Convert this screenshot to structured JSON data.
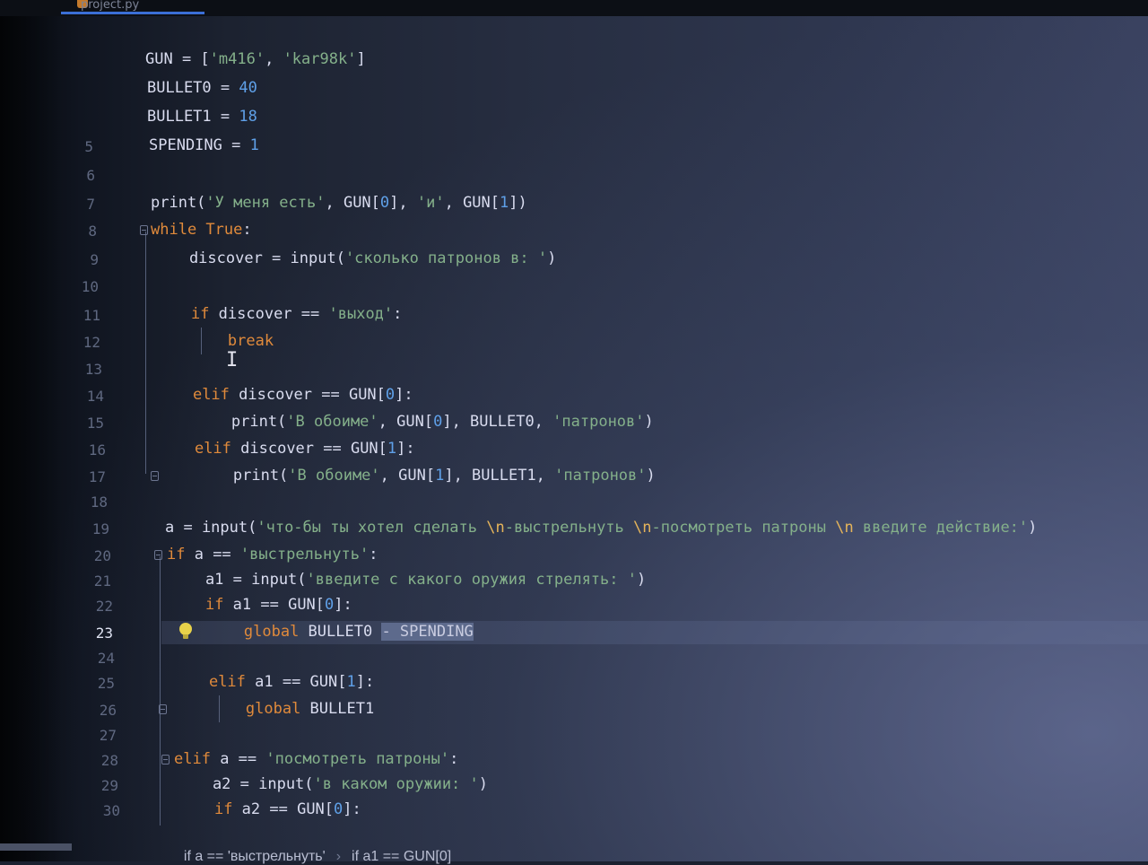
{
  "tab": {
    "label": "project.py"
  },
  "editor": {
    "lines": [
      {
        "n": "",
        "segs": [
          [
            "GUN = [",
            "d"
          ],
          [
            "'m416'",
            "s"
          ],
          [
            ", ",
            "d"
          ],
          [
            "'kar98k'",
            "s"
          ],
          [
            "]",
            "d"
          ]
        ]
      },
      {
        "n": "",
        "segs": [
          [
            "BULLET0 = ",
            "d"
          ],
          [
            "40",
            "n"
          ]
        ]
      },
      {
        "n": "",
        "segs": [
          [
            "BULLET1 = ",
            "d"
          ],
          [
            "18",
            "n"
          ]
        ]
      },
      {
        "n": "5",
        "segs": [
          [
            "SPENDING = ",
            "d"
          ],
          [
            "1",
            "n"
          ]
        ]
      },
      {
        "n": "6",
        "segs": []
      },
      {
        "n": "7",
        "segs": [
          [
            "print(",
            "d"
          ],
          [
            "'У меня есть'",
            "s"
          ],
          [
            ", GUN[",
            "d"
          ],
          [
            "0",
            "n"
          ],
          [
            "], ",
            "d"
          ],
          [
            "'и'",
            "s"
          ],
          [
            ", GUN[",
            "d"
          ],
          [
            "1",
            "n"
          ],
          [
            "])",
            "d"
          ]
        ]
      },
      {
        "n": "8",
        "segs": [
          [
            "while True",
            "k"
          ],
          [
            ":",
            "d"
          ]
        ]
      },
      {
        "n": "9",
        "segs": [
          [
            "    discover = input(",
            "d"
          ],
          [
            "'сколько патронов в: '",
            "s"
          ],
          [
            ")",
            "d"
          ]
        ]
      },
      {
        "n": "10",
        "segs": []
      },
      {
        "n": "11",
        "segs": [
          [
            "    ",
            "d"
          ],
          [
            "if",
            "k"
          ],
          [
            " discover == ",
            "d"
          ],
          [
            "'выход'",
            "s"
          ],
          [
            ":",
            "d"
          ]
        ]
      },
      {
        "n": "12",
        "segs": [
          [
            "        ",
            "d"
          ],
          [
            "break",
            "k"
          ]
        ]
      },
      {
        "n": "13",
        "segs": []
      },
      {
        "n": "14",
        "segs": [
          [
            "    ",
            "d"
          ],
          [
            "elif",
            "k"
          ],
          [
            " discover == GUN[",
            "d"
          ],
          [
            "0",
            "n"
          ],
          [
            "]:",
            "d"
          ]
        ]
      },
      {
        "n": "15",
        "segs": [
          [
            "        print(",
            "d"
          ],
          [
            "'В обоиме'",
            "s"
          ],
          [
            ", GUN[",
            "d"
          ],
          [
            "0",
            "n"
          ],
          [
            "], BULLET0, ",
            "d"
          ],
          [
            "'патронов'",
            "s"
          ],
          [
            ")",
            "d"
          ]
        ]
      },
      {
        "n": "16",
        "segs": [
          [
            "    ",
            "d"
          ],
          [
            "elif",
            "k"
          ],
          [
            " discover == GUN[",
            "d"
          ],
          [
            "1",
            "n"
          ],
          [
            "]:",
            "d"
          ]
        ]
      },
      {
        "n": "17",
        "segs": [
          [
            "        print(",
            "d"
          ],
          [
            "'В обоиме'",
            "s"
          ],
          [
            ", GUN[",
            "d"
          ],
          [
            "1",
            "n"
          ],
          [
            "], BULLET1, ",
            "d"
          ],
          [
            "'патронов'",
            "s"
          ],
          [
            ")",
            "d"
          ]
        ]
      },
      {
        "n": "18",
        "segs": []
      },
      {
        "n": "19",
        "segs": [
          [
            "a = input(",
            "d"
          ],
          [
            "'что-бы ты хотел сделать ",
            "s"
          ],
          [
            "\\n",
            "e"
          ],
          [
            "-выстрельнуть ",
            "s"
          ],
          [
            "\\n",
            "e"
          ],
          [
            "-посмотреть патроны ",
            "s"
          ],
          [
            "\\n",
            "e"
          ],
          [
            " введите действие:'",
            "s"
          ],
          [
            ")",
            "d"
          ]
        ]
      },
      {
        "n": "20",
        "segs": [
          [
            "if",
            "k"
          ],
          [
            " a == ",
            "d"
          ],
          [
            "'выстрельнуть'",
            "s"
          ],
          [
            ":",
            "d"
          ]
        ]
      },
      {
        "n": "21",
        "segs": [
          [
            "    a1 = input(",
            "d"
          ],
          [
            "'введите с какого оружия стрелять: '",
            "s"
          ],
          [
            ")",
            "d"
          ]
        ]
      },
      {
        "n": "22",
        "segs": [
          [
            "    ",
            "d"
          ],
          [
            "if",
            "k"
          ],
          [
            " a1 == GUN[",
            "d"
          ],
          [
            "0",
            "n"
          ],
          [
            "]:",
            "d"
          ]
        ]
      },
      {
        "n": "23",
        "segs": [
          [
            "        ",
            "d"
          ],
          [
            "global",
            "k"
          ],
          [
            " BULLET0 ",
            "d"
          ],
          [
            "- SPENDING",
            "h"
          ]
        ]
      },
      {
        "n": "24",
        "segs": []
      },
      {
        "n": "25",
        "segs": [
          [
            "    ",
            "d"
          ],
          [
            "elif",
            "k"
          ],
          [
            " a1 == GUN[",
            "d"
          ],
          [
            "1",
            "n"
          ],
          [
            "]:",
            "d"
          ]
        ]
      },
      {
        "n": "26",
        "segs": [
          [
            "        ",
            "d"
          ],
          [
            "global",
            "k"
          ],
          [
            " BULLET1",
            "d"
          ]
        ]
      },
      {
        "n": "27",
        "segs": []
      },
      {
        "n": "28",
        "segs": [
          [
            "elif",
            "k"
          ],
          [
            " a == ",
            "d"
          ],
          [
            "'посмотреть патроны'",
            "s"
          ],
          [
            ":",
            "d"
          ]
        ]
      },
      {
        "n": "29",
        "segs": [
          [
            "    a2 = input(",
            "d"
          ],
          [
            "'в каком оружии: '",
            "s"
          ],
          [
            ")",
            "d"
          ]
        ]
      },
      {
        "n": "30",
        "segs": [
          [
            "    ",
            "d"
          ],
          [
            "if",
            "k"
          ],
          [
            " a2 == GUN[",
            "d"
          ],
          [
            "0",
            "n"
          ],
          [
            "]:",
            "d"
          ]
        ]
      }
    ]
  },
  "breadcrumbs": [
    "if a == 'выстрельнуть'",
    "if a1 == GUN[0]"
  ],
  "colors": {
    "keyword": "#e08a3b",
    "string": "#84b08a",
    "number": "#5fa0e8",
    "escape": "#e5b45a",
    "default": "#d9dcef",
    "line_number": "#5f6880",
    "current_line_number": "#dfe3f2"
  },
  "current_line": "23"
}
